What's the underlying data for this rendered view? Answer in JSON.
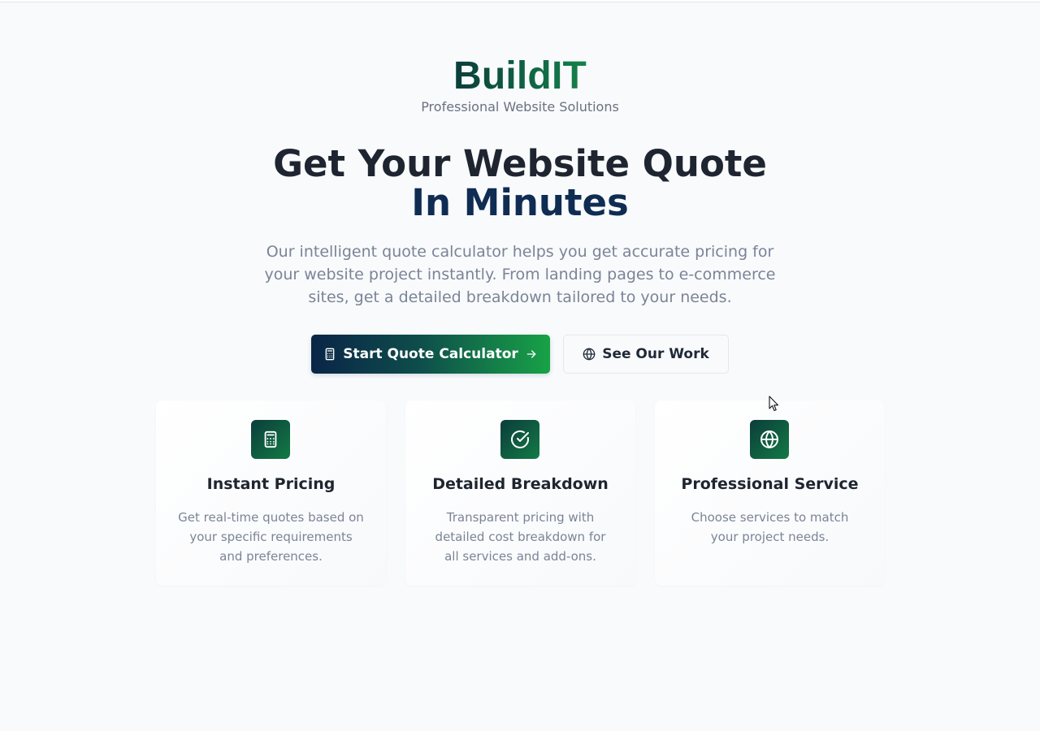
{
  "brand": {
    "name": "BuildIT",
    "tagline": "Professional Website Solutions"
  },
  "hero": {
    "title_line1": "Get Your Website Quote",
    "title_line2": "In Minutes",
    "description": "Our intelligent quote calculator helps you get accurate pricing for your website project instantly. From landing pages to e-commerce sites, get a detailed breakdown tailored to your needs."
  },
  "actions": {
    "primary_label": "Start Quote Calculator",
    "primary_icon": "calculator-icon",
    "primary_trailing_icon": "arrow-right-icon",
    "secondary_label": "See Our Work",
    "secondary_icon": "globe-icon"
  },
  "features": [
    {
      "icon": "calculator-icon",
      "title": "Instant Pricing",
      "description": "Get real-time quotes based on your specific requirements and preferences."
    },
    {
      "icon": "check-circle-icon",
      "title": "Detailed Breakdown",
      "description": "Transparent pricing with detailed cost breakdown for all services and add-ons."
    },
    {
      "icon": "globe-icon",
      "title": "Professional Service",
      "description": "Choose services to match your project needs."
    }
  ],
  "colors": {
    "background": "#f8fafc",
    "brand_dark": "#0b3d3b",
    "brand_green": "#15814a",
    "navy": "#0f2c52",
    "muted_text": "#7b8496"
  }
}
